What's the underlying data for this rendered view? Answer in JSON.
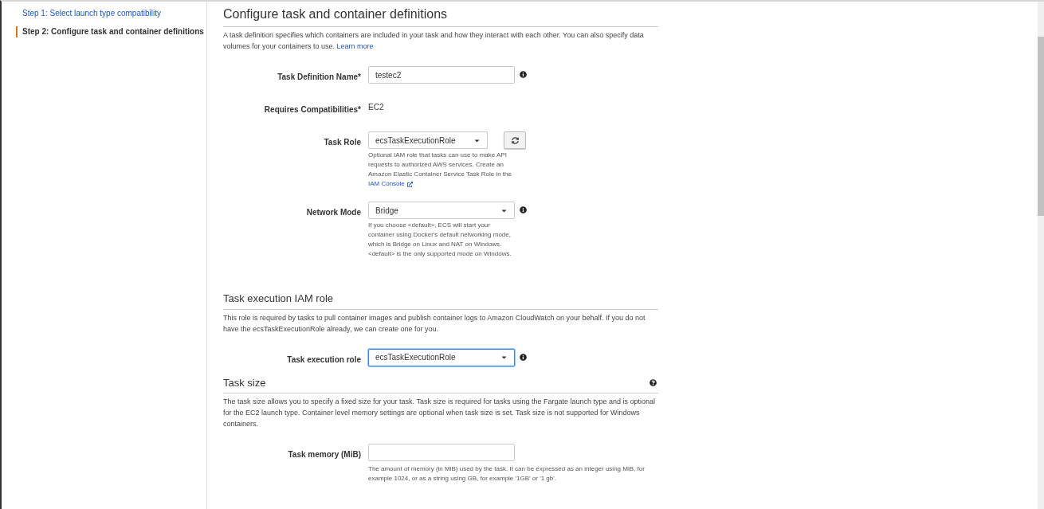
{
  "steps": [
    {
      "label": "Step 1: Select launch type compatibility",
      "selected": false
    },
    {
      "label": "Step 2: Configure task and container definitions",
      "selected": true
    }
  ],
  "sections": [
    {
      "title": "Configure task and container definitions",
      "big": true,
      "help": false,
      "description": "A task definition specifies which containers are included in your task and how they interact with each other. You can also specify data volumes for your containers to use.",
      "link": "Learn more",
      "fields": [
        {
          "kind": "text",
          "label": "Task Definition Name*",
          "value": "testec2",
          "info": true,
          "focused": false
        },
        {
          "kind": "static",
          "label": "Requires Compatibilities*",
          "value": "EC2",
          "info": false
        },
        {
          "kind": "select",
          "label": "Task Role",
          "value": "ecsTaskExecutionRole",
          "info": false,
          "refresh": true,
          "focused": false,
          "helper": "Optional IAM role that tasks can use to make API requests to authorized AWS services. Create an Amazon Elastic Container Service Task Role in the",
          "helper_link": "IAM Console"
        },
        {
          "kind": "select",
          "label": "Network Mode",
          "value": "Bridge",
          "info": true,
          "refresh": false,
          "focused": false,
          "helper": "If you choose <default>, ECS will start your container using Docker's default networking mode, which is Bridge on Linux and NAT on Windows. <default> is the only supported mode on Windows."
        }
      ]
    },
    {
      "title": "Task execution IAM role",
      "big": false,
      "help": false,
      "description": "This role is required by tasks to pull container images and publish container logs to Amazon CloudWatch on your behalf. If you do not have the ecsTaskExecutionRole already, we can create one for you.",
      "fields": [
        {
          "kind": "select",
          "label": "Task execution role",
          "value": "ecsTaskExecutionRole",
          "info": true,
          "refresh": false,
          "focused": true
        }
      ]
    },
    {
      "title": "Task size",
      "big": false,
      "help": true,
      "description": "The task size allows you to specify a fixed size for your task. Task size is required for tasks using the Fargate launch type and is optional for the EC2 launch type. Container level memory settings are optional when task size is set. Task size is not supported for Windows containers.",
      "fields": [
        {
          "kind": "text",
          "label": "Task memory (MiB)",
          "info": false,
          "focused": false,
          "helper": "The amount of memory (in MiB) used by the task. It can be expressed as an integer using MiB, for example 1024, or as a string using GB, for example '1GB' or '1 gb'."
        }
      ]
    }
  ]
}
